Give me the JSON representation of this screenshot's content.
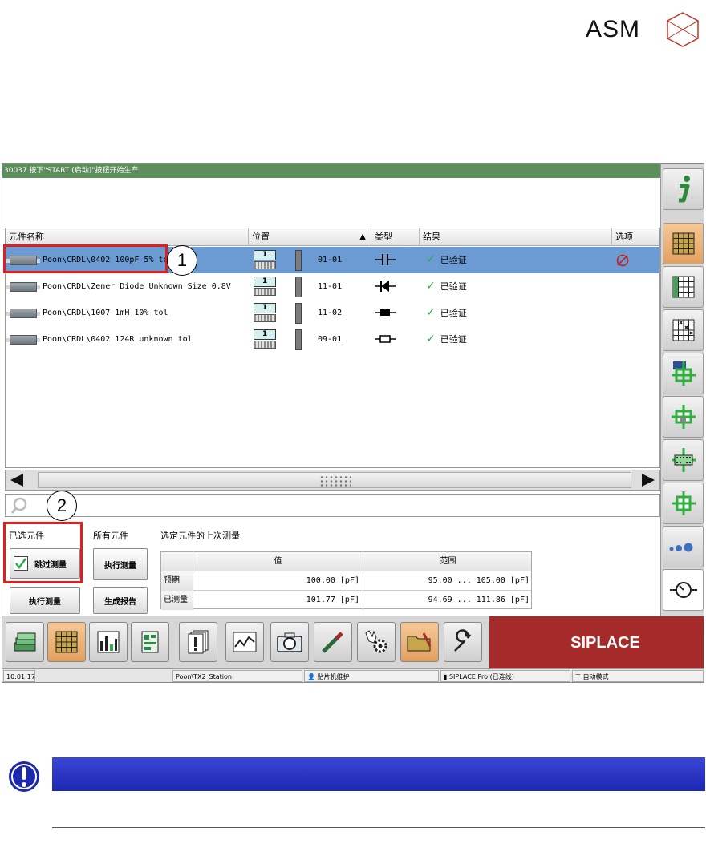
{
  "brand": {
    "logo_text": "ASM"
  },
  "app": {
    "message": "30037 按下\"START (启动)\"按钮开始生产",
    "table": {
      "headers": {
        "name": "元件名称",
        "position": "位置",
        "type": "类型",
        "result": "结果",
        "options": "选项"
      },
      "rows": [
        {
          "name": "Poon\\CRDL\\0402 100pF 5% tol",
          "feeder_num": "1",
          "position": "01-01",
          "type_icon": "capacitor-symbol-icon",
          "result": "已验证",
          "selected": true,
          "option_icon": "not-allowed-icon"
        },
        {
          "name": "Poon\\CRDL\\Zener Diode Unknown Size 0.8V",
          "feeder_num": "1",
          "position": "11-01",
          "type_icon": "diode-symbol-icon",
          "result": "已验证",
          "selected": false
        },
        {
          "name": "Poon\\CRDL\\1007 1mH 10% tol",
          "feeder_num": "1",
          "position": "11-02",
          "type_icon": "inductor-symbol-icon",
          "result": "已验证",
          "selected": false
        },
        {
          "name": "Poon\\CRDL\\0402 124R unknown tol",
          "feeder_num": "1",
          "position": "09-01",
          "type_icon": "resistor-symbol-icon",
          "result": "已验证",
          "selected": false
        }
      ]
    },
    "search": {
      "placeholder": ""
    },
    "panel": {
      "selected_title": "已选元件",
      "all_title": "所有元件",
      "last_measure_title": "选定元件的上次测量",
      "skip_button": "跳过测量",
      "execute_selected": "执行测量",
      "execute_all": "执行测量",
      "report_button": "生成报告",
      "skip_checked": true,
      "measurement": {
        "col_value": "值",
        "col_range": "范围",
        "rows": [
          {
            "label": "预期",
            "value": "100.00 [pF]",
            "range": "95.00 ... 105.00 [pF]"
          },
          {
            "label": "已测量",
            "value": "101.77 [pF]",
            "range": "94.69 ... 111.86 [pF]"
          }
        ]
      }
    },
    "toolbar": {
      "buttons": [
        "stack-icon",
        "component-grid-icon",
        "bar-levels-icon",
        "board-icon",
        "warning-docs-icon",
        "chart-icon",
        "camera-icon",
        "tool-icon",
        "hand-gear-icon",
        "folder-icon",
        "wrench-icon"
      ],
      "active": [
        "component-grid-icon",
        "folder-icon"
      ],
      "brand": "SIPLACE"
    },
    "status": {
      "time": "10:01:17",
      "station": "Poon\\TX2_Station",
      "maintenance": "贴片机维护",
      "connection": "SIPLACE Pro (已连线)",
      "mode": "自动模式"
    },
    "sidebar": [
      "info-icon",
      "components-grid-icon",
      "components-grid-check-icon",
      "components-grid-x-icon",
      "feeder-pickup-icon",
      "placement-head-icon",
      "board-pcb-icon",
      "target-cross-icon",
      "blobs-icon",
      "timer-gauge-icon"
    ]
  },
  "callouts": {
    "one": "1",
    "two": "2"
  },
  "colors": {
    "selection": "#6b9bd2",
    "siplace": "#a52a2a",
    "callout": "#e01e1e",
    "message_bar": "#5c8f5c",
    "note_bar": "#1c28b0"
  }
}
